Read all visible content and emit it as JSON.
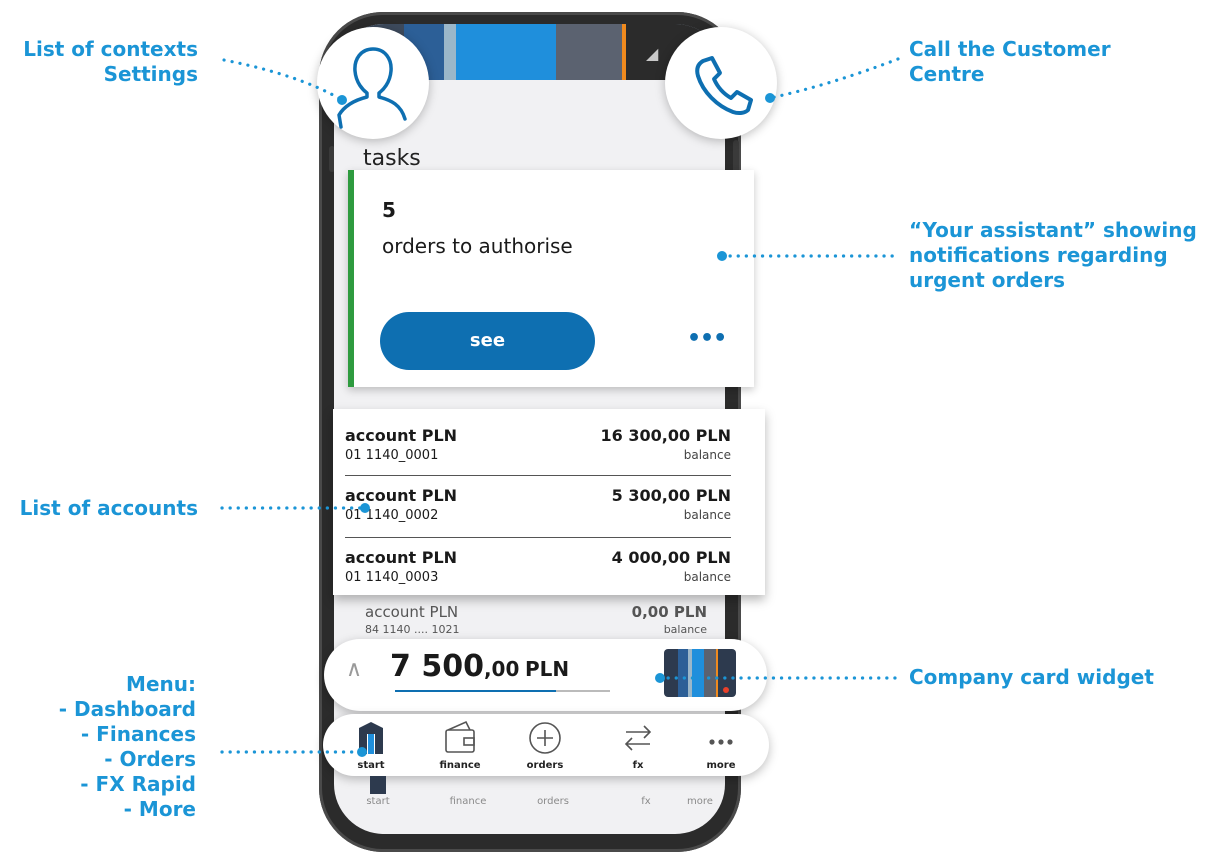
{
  "annotations": {
    "contexts": [
      "List of contexts",
      "Settings"
    ],
    "call": [
      "Call the Customer",
      "Centre"
    ],
    "assistant": [
      "“Your assistant” showing",
      "notifications regarding",
      "urgent orders"
    ],
    "accounts": "List of accounts",
    "company_card": "Company card widget",
    "menu": [
      "Menu:",
      "- Dashboard",
      "- Finances",
      "- Orders",
      "- FX Rapid",
      "- More"
    ]
  },
  "screen": {
    "tasks_title": "tasks",
    "assistant": {
      "count": "5",
      "text": "orders to authorise",
      "button": "see",
      "more": "•••"
    },
    "accounts": [
      {
        "name": "account PLN",
        "number": "01 1140_0001",
        "amount": "16 300,00 PLN",
        "label": "balance"
      },
      {
        "name": "account PLN",
        "number": "01 1140_0002",
        "amount": "5 300,00 PLN",
        "label": "balance"
      },
      {
        "name": "account PLN",
        "number": "01 1140_0003",
        "amount": "4 000,00 PLN",
        "label": "balance"
      }
    ],
    "background_account": {
      "name": "account PLN",
      "number": "84 1140 .... 1021",
      "amount": "0,00 PLN",
      "label": "balance"
    },
    "total": {
      "main": "7 500",
      "cents": ",00",
      "currency": "PLN",
      "progress": 0.75
    },
    "nav": [
      {
        "label": "start",
        "icon": "building-icon"
      },
      {
        "label": "finance",
        "icon": "wallet-icon"
      },
      {
        "label": "orders",
        "icon": "plus-circle-icon"
      },
      {
        "label": "fx",
        "icon": "exchange-arrows-icon"
      },
      {
        "label": "more",
        "icon": "more-dots-icon"
      }
    ]
  },
  "colors": {
    "annotation": "#1b95d6",
    "primary": "#0e6fb1",
    "assistant_accent": "#2e9b3f"
  }
}
